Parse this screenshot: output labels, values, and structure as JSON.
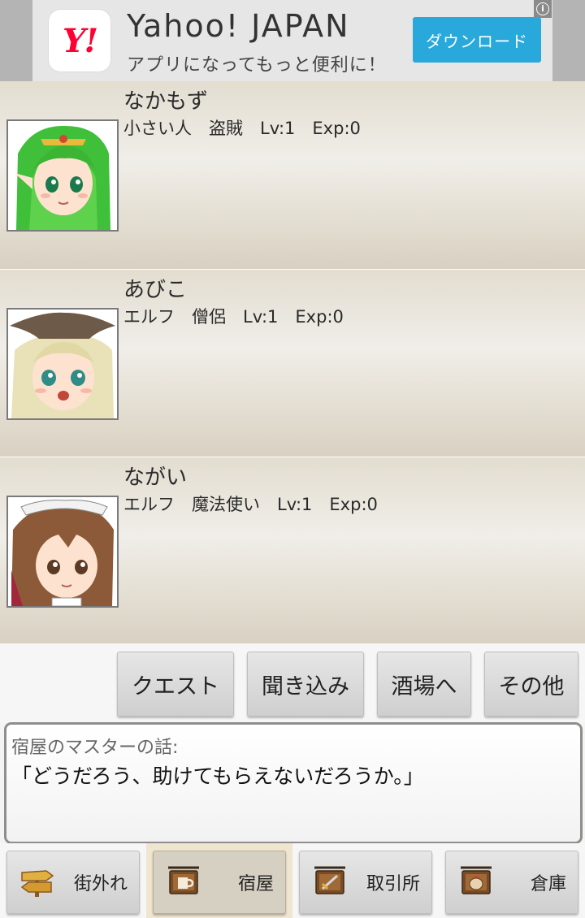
{
  "ad": {
    "logo_text": "Y!",
    "title": "Yahoo! JAPAN",
    "subtitle": "アプリになってもっと便利に！",
    "button_label": "ダウンロード",
    "info_glyph": "i"
  },
  "party": [
    {
      "name": "なかもず",
      "stats": "小さい人　盗賊　Lv:1　Exp:0",
      "portrait": "green-haired-elf-portrait"
    },
    {
      "name": "あびこ",
      "stats": "エルフ　僧侶　Lv:1　Exp:0",
      "portrait": "blonde-hat-girl-portrait"
    },
    {
      "name": "ながい",
      "stats": "エルフ　魔法使い　Lv:1　Exp:0",
      "portrait": "brown-haired-maid-portrait"
    }
  ],
  "actions": {
    "quest": "クエスト",
    "inquire": "聞き込み",
    "tavern": "酒場へ",
    "other": "その他"
  },
  "message": {
    "speaker": "宿屋のマスターの話:",
    "text": "「どうだろう、助けてもらえないだろうか。」"
  },
  "nav": {
    "outskirts": "街外れ",
    "inn": "宿屋",
    "market": "取引所",
    "warehouse": "倉庫",
    "active": "inn"
  },
  "colors": {
    "ad_button": "#29a8dc",
    "yahoo_red": "#ff0033",
    "list_bg": "#e3ddd0",
    "nav_active": "#f0e6cf"
  }
}
